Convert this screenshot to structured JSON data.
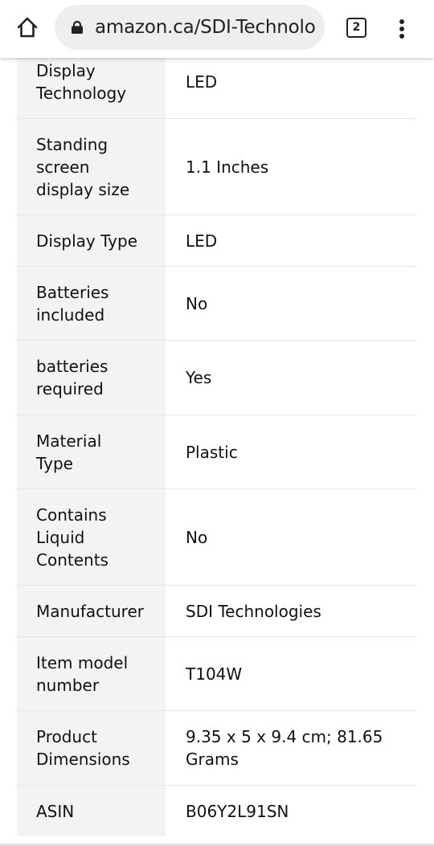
{
  "browser": {
    "url": "amazon.ca/SDI-Technolo",
    "tab_count": "2",
    "icons": {
      "home": "home-icon",
      "lock": "lock-icon",
      "tabs": "tab-switcher-icon",
      "menu": "more-vert-icon"
    }
  },
  "specs": [
    {
      "label": "Display Technology",
      "value": "LED"
    },
    {
      "label": "Standing screen display size",
      "value": "1.1 Inches"
    },
    {
      "label": "Display Type",
      "value": "LED"
    },
    {
      "label": "Batteries included",
      "value": "No"
    },
    {
      "label": "batteries required",
      "value": "Yes"
    },
    {
      "label": "Material Type",
      "value": "Plastic"
    },
    {
      "label": "Contains Liquid Contents",
      "value": "No"
    },
    {
      "label": "Manufacturer",
      "value": "SDI Technologies"
    },
    {
      "label": "Item model number",
      "value": "T104W"
    },
    {
      "label": "Product Dimensions",
      "value": "9.35 x 5 x 9.4 cm; 81.65 Grams"
    },
    {
      "label": "ASIN",
      "value": "B06Y2L91SN"
    }
  ],
  "colors": {
    "label_bg": "#f3f3f3",
    "divider": "#e7e7e7",
    "text": "#111111"
  }
}
